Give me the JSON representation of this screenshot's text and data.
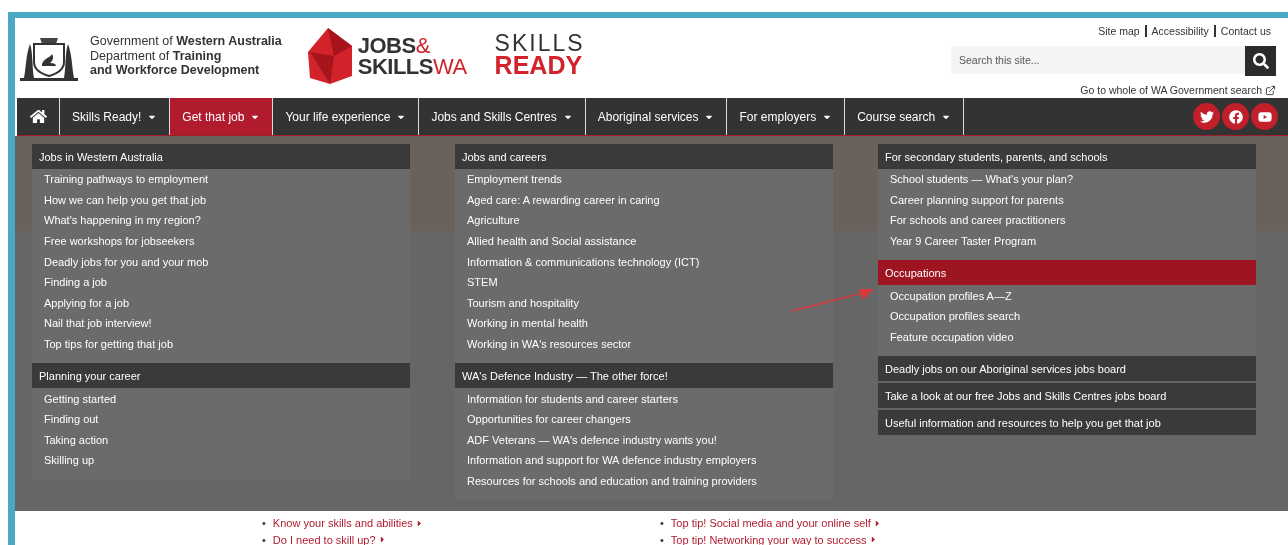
{
  "header": {
    "org_lines": [
      "Government of **Western Australia**",
      "Department of **Training**",
      "**and Workforce Development**"
    ],
    "jobs_logo": {
      "line1": "JOBS",
      "amp": "&",
      "line2": "SKILLS",
      "wa": "WA"
    },
    "skills_logo": {
      "line1": "SKILLS",
      "line2": "READY"
    },
    "top_links": [
      "Site map",
      "Accessibility",
      "Contact us"
    ],
    "search": {
      "placeholder": "Search this site..."
    },
    "gov_search": "Go to whole of WA Government search"
  },
  "nav": [
    {
      "label": "Skills Ready!",
      "selected": false
    },
    {
      "label": "Get that job",
      "selected": true
    },
    {
      "label": "Your life experience",
      "selected": false
    },
    {
      "label": "Jobs and Skills Centres",
      "selected": false
    },
    {
      "label": "Aboriginal services",
      "selected": false
    },
    {
      "label": "For employers",
      "selected": false
    },
    {
      "label": "Course search",
      "selected": false
    }
  ],
  "menu": {
    "columns": [
      {
        "sections": [
          {
            "heading": "Jobs in Western Australia",
            "selected": false,
            "items": [
              "Training pathways to employment",
              "How we can help you get that job",
              "What's happening in my region?",
              "Free workshops for jobseekers",
              "Deadly jobs for you and your mob",
              "Finding a job",
              "Applying for a job",
              "Nail that job interview!",
              "Top tips for getting that job"
            ]
          },
          {
            "heading": "Planning your career",
            "selected": false,
            "items": [
              "Getting started",
              "Finding out",
              "Taking action",
              "Skilling up"
            ]
          }
        ]
      },
      {
        "sections": [
          {
            "heading": "Jobs and careers",
            "selected": false,
            "items": [
              "Employment trends",
              "Aged care: A rewarding career in caring",
              "Agriculture",
              "Allied health and Social assistance",
              "Information & communications technology (ICT)",
              "STEM",
              "Tourism and hospitality",
              "Working in mental health",
              "Working in WA's resources sector"
            ]
          },
          {
            "heading": "WA's Defence Industry — The other force!",
            "selected": false,
            "items": [
              "Information for students and career starters",
              "Opportunities for career changers",
              "ADF Veterans — WA's defence industry wants you!",
              "Information and support for WA defence industry employers",
              "Resources for schools and education and training providers"
            ]
          }
        ]
      },
      {
        "sections": [
          {
            "heading": "For secondary students, parents, and schools",
            "selected": false,
            "items": [
              "School students — What's your plan?",
              "Career planning support for parents",
              "For schools and career practitioners",
              "Year 9 Career Taster Program"
            ]
          },
          {
            "heading": "Occupations",
            "selected": true,
            "items": [
              "Occupation profiles A—Z",
              "Occupation profiles search",
              "Feature occupation video"
            ]
          },
          {
            "heading": "Deadly jobs on our Aboriginal services jobs board",
            "selected": false
          },
          {
            "heading": "Take a look at our free Jobs and Skills Centres jobs board",
            "selected": false
          },
          {
            "heading": "Useful information and resources to help you get that job",
            "selected": false
          }
        ]
      }
    ]
  },
  "page_links": [
    [
      {
        "marker": "•",
        "text": "Know your skills and abilities"
      },
      {
        "marker": "•",
        "text": "Do I need to skill up?"
      }
    ],
    [
      {
        "marker": "•",
        "text": "Top tip! Social media and your online self"
      },
      {
        "marker": "•",
        "text": "Top tip! Networking your way to success"
      }
    ]
  ]
}
